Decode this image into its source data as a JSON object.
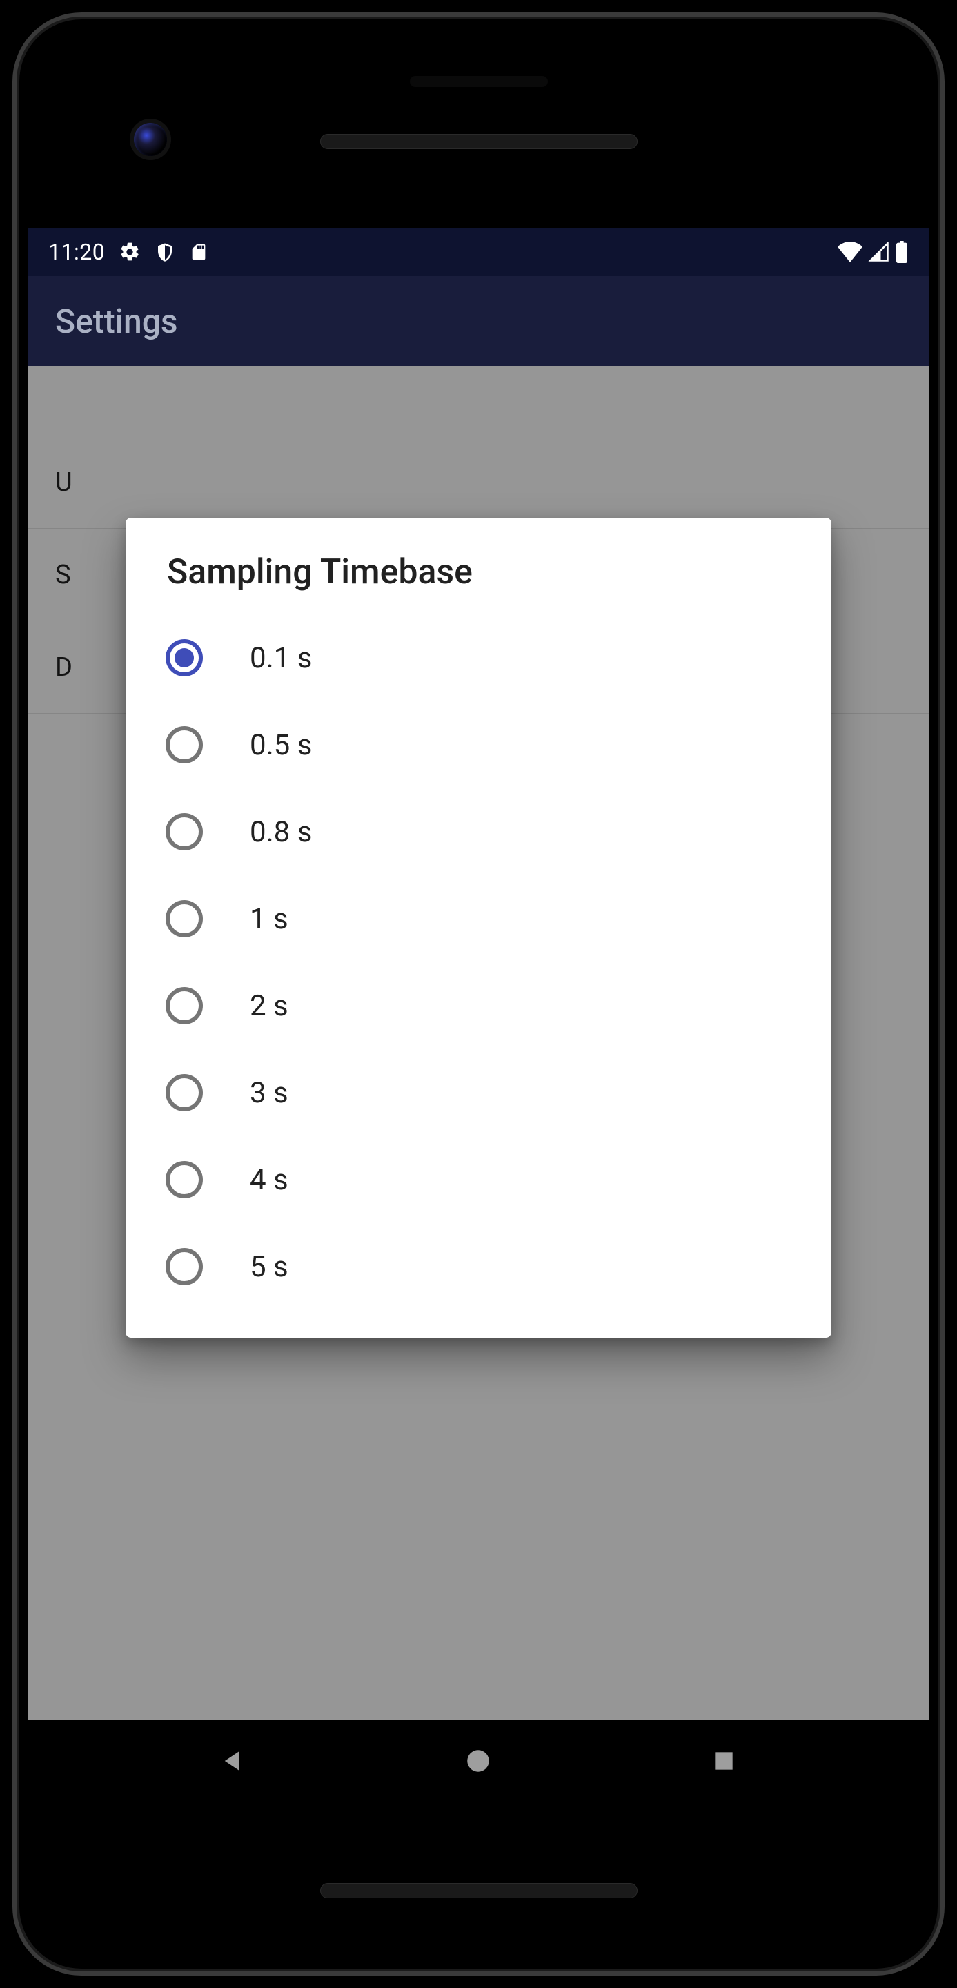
{
  "status_bar": {
    "time": "11:20"
  },
  "app_bar": {
    "title": "Settings"
  },
  "bg_items": [
    {
      "letter": "U"
    },
    {
      "letter": "S"
    },
    {
      "letter": "D"
    }
  ],
  "dialog": {
    "title": "Sampling Timebase",
    "options": [
      {
        "label": "0.1 s",
        "selected": true
      },
      {
        "label": "0.5 s",
        "selected": false
      },
      {
        "label": "0.8 s",
        "selected": false
      },
      {
        "label": "1 s",
        "selected": false
      },
      {
        "label": "2 s",
        "selected": false
      },
      {
        "label": "3 s",
        "selected": false
      },
      {
        "label": "4 s",
        "selected": false
      },
      {
        "label": "5 s",
        "selected": false
      }
    ]
  }
}
